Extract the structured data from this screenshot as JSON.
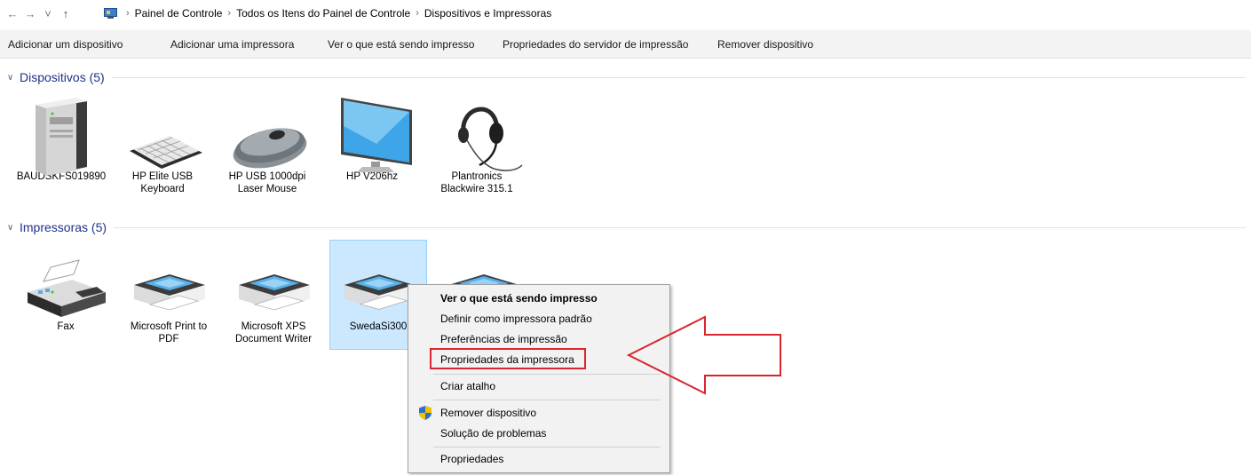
{
  "address_bar": {
    "back_icon": "←",
    "forward_icon": "→",
    "recent_icon": "˅",
    "up_icon": "↑",
    "crumbs": [
      "Painel de Controle",
      "Todos os Itens do Painel de Controle",
      "Dispositivos e Impressoras"
    ],
    "separator": "›"
  },
  "toolbar": {
    "add_device": "Adicionar um dispositivo",
    "add_printer": "Adicionar uma impressora",
    "see_printing": "Ver o que está sendo impresso",
    "server_props": "Propriedades do servidor de impressão",
    "remove_device": "Remover dispositivo"
  },
  "groups": {
    "devices": {
      "title": "Dispositivos (5)",
      "items": [
        {
          "label": "BAUDSKFS019890",
          "icon": "computer-icon"
        },
        {
          "label": "HP Elite USB Keyboard",
          "icon": "keyboard-icon"
        },
        {
          "label": "HP USB 1000dpi Laser Mouse",
          "icon": "mouse-icon"
        },
        {
          "label": "HP V206hz",
          "icon": "monitor-icon"
        },
        {
          "label": "Plantronics Blackwire 315.1",
          "icon": "headset-icon"
        }
      ]
    },
    "printers": {
      "title": "Impressoras (5)",
      "items": [
        {
          "label": "Fax",
          "icon": "fax-icon"
        },
        {
          "label": "Microsoft Print to PDF",
          "icon": "printer-icon"
        },
        {
          "label": "Microsoft XPS Document Writer",
          "icon": "printer-icon"
        },
        {
          "label": "SwedaSi300",
          "icon": "printer-icon",
          "selected": true
        },
        {
          "label": "",
          "icon": "printer-icon"
        }
      ]
    }
  },
  "context_menu": {
    "items": [
      {
        "label": "Ver o que está sendo impresso",
        "bold": true
      },
      {
        "label": "Definir como impressora padrão"
      },
      {
        "label": "Preferências de impressão"
      },
      {
        "label": "Propriedades da impressora",
        "highlighted": true
      },
      {
        "label": "Criar atalho"
      },
      {
        "label": "Remover dispositivo",
        "icon": "shield-icon"
      },
      {
        "label": "Solução de problemas"
      },
      {
        "label": "Propriedades"
      }
    ]
  },
  "colors": {
    "group_title": "#1e3287",
    "selection_bg": "#cce8ff",
    "highlight_red": "#d9262e"
  }
}
